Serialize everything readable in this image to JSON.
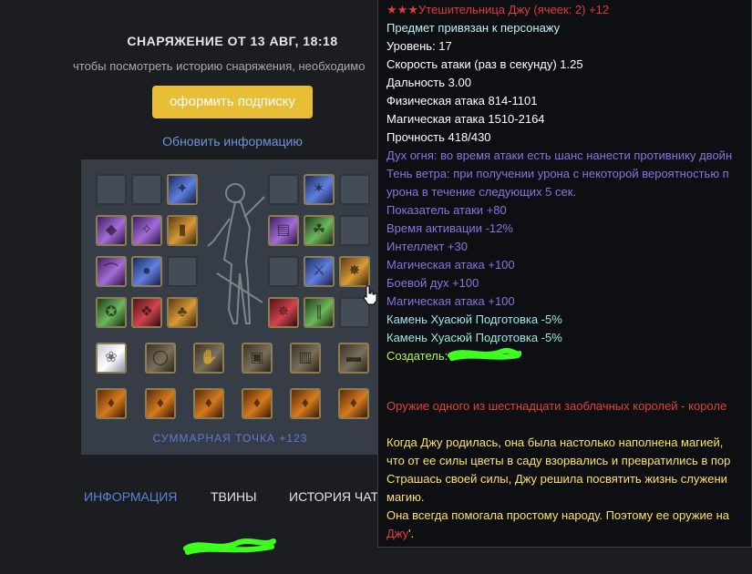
{
  "header": {
    "title": "СНАРЯЖЕНИЕ ОТ 13 АВГ, 18:18",
    "hint": "чтобы посмотреть историю снаряжения, необходимо",
    "subscribe_label": "оформить подписку",
    "refresh_label": "Обновить информацию"
  },
  "equipment": {
    "summary": "СУММАРНАЯ ТОЧКА +123"
  },
  "tabs": {
    "info": "ИНФОРМАЦИЯ",
    "twins": "ТВИНЫ",
    "history": "ИСТОРИЯ ЧАТА"
  },
  "tooltip": {
    "name": "★★★Утешительница Джу (ячеек: 2) +12",
    "bound": "Предмет привязан к персонажу",
    "level": "Уровень: 17",
    "speed": "Скорость атаки (раз в секунду) 1.25",
    "range": "Дальность 3.00",
    "phys": "Физическая атака 814-1101",
    "mag": "Магическая атака 1510-2164",
    "durability": "Прочность 418/430",
    "skill1": "Дух огня: во время атаки есть шанс нанести противнику двойн",
    "skill2a": "Тень ветра: при получении урона с некоторой вероятностью п",
    "skill2b": "урона в течение следующих 5 сек.",
    "add1": "Показатель атаки +80",
    "add2": "Время активации -12%",
    "add3": "Интеллект +30",
    "add4": "Магическая атака +100",
    "add5": "Боевой дух +100",
    "add6": "Магическая атака +100",
    "stone1": "Камень Хуасюй Подготовка -5%",
    "stone2": "Камень Хуасюй Подготовка -5%",
    "creator": "Создатель:",
    "desc_red": "Оружие одного из шестнадцати заоблачных королей - короле",
    "lore1": "Когда Джу родилась, она была настолько наполнена магией,",
    "lore2": "что от ее силы цветы в саду взорвались и превратились в пор",
    "lore3": "Страшась своей силы, Джу решила посвятить жизнь служени",
    "lore4": "магию.",
    "lore5": "Она всегда помогала простому народу. Поэтому ее оружие на",
    "lore6a": "Джу",
    "lore6b": "'."
  }
}
